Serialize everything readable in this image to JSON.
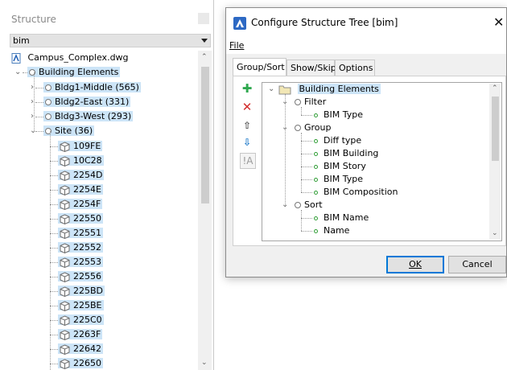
{
  "structure_panel": {
    "title": "Structure",
    "combo_value": "bim",
    "root": "Campus_Complex.dwg",
    "building_elements": "Building Elements",
    "buildings": [
      "Bldg1-Middle (565)",
      "Bldg2-East (331)",
      "Bldg3-West (293)"
    ],
    "site": "Site (36)",
    "site_items": [
      "109FE",
      "10C28",
      "2254D",
      "2254E",
      "2254F",
      "22550",
      "22551",
      "22552",
      "22553",
      "22556",
      "225BD",
      "225BE",
      "225C0",
      "2263F",
      "22642",
      "22650"
    ]
  },
  "dialog": {
    "title": "Configure Structure Tree [bim]",
    "menu_file": "File",
    "tabs": [
      "Group/Sort",
      "Show/Skip",
      "Options"
    ],
    "tree": {
      "root": "Building Elements",
      "filter": "Filter",
      "filter_items": [
        "BIM Type"
      ],
      "group": "Group",
      "group_items": [
        "Diff type",
        "BIM Building",
        "BIM Story",
        "BIM Type",
        "BIM Composition"
      ],
      "sort": "Sort",
      "sort_items": [
        "BIM Name",
        "Name"
      ]
    },
    "ok_label": "OK",
    "cancel_label": "Cancel"
  },
  "colors": {
    "selection": "#cce4f7",
    "add": "#2fa84f",
    "remove": "#d32f2f",
    "accent": "#0078d7"
  },
  "icons": [
    "dwg-file-icon",
    "circle-node-icon",
    "cube-icon",
    "plus-icon",
    "x-icon",
    "arrow-up-icon",
    "arrow-down-icon",
    "text-A-icon",
    "folder-icon"
  ]
}
